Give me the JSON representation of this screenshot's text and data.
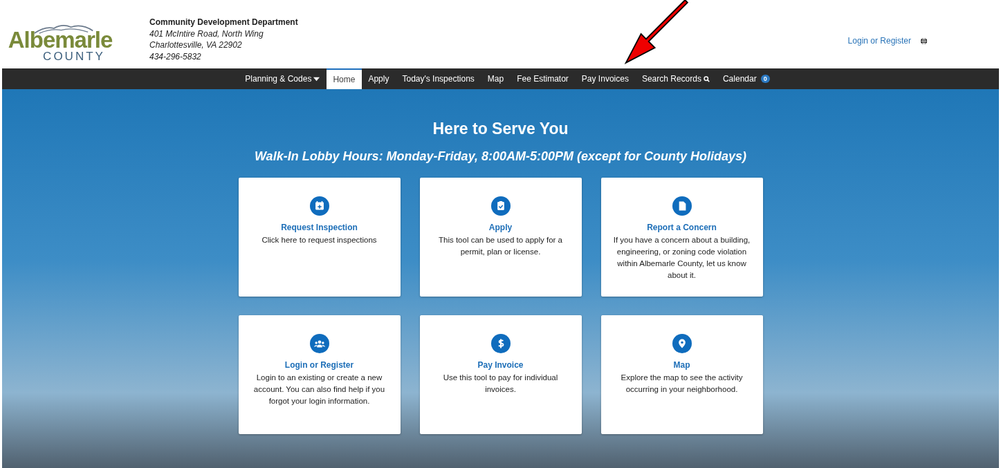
{
  "logo": {
    "name": "Albemarle",
    "sub": "COUNTY"
  },
  "department": {
    "name": "Community Development Department",
    "address_1": "401 McIntire Road, North Wing",
    "address_2": "Charlottesville, VA 22902",
    "phone": "434-296-5832"
  },
  "account_link": "Login or Register",
  "nav": [
    {
      "label": "Planning & Codes",
      "kind": "dropdown",
      "selected": false
    },
    {
      "label": "Home",
      "kind": "plain",
      "selected": true
    },
    {
      "label": "Apply",
      "kind": "plain",
      "selected": false
    },
    {
      "label": "Today's Inspections",
      "kind": "plain",
      "selected": false
    },
    {
      "label": "Map",
      "kind": "plain",
      "selected": false
    },
    {
      "label": "Fee Estimator",
      "kind": "plain",
      "selected": false
    },
    {
      "label": "Pay Invoices",
      "kind": "plain",
      "selected": false
    },
    {
      "label": "Search Records",
      "kind": "search",
      "selected": false
    },
    {
      "label": "Calendar",
      "kind": "badge",
      "badge": "0",
      "selected": false
    }
  ],
  "hero": {
    "title": "Here to Serve You",
    "subtitle": "Walk-In Lobby Hours: Monday-Friday, 8:00AM-5:00PM (except for County Holidays)"
  },
  "cards": [
    {
      "kind": "calendar",
      "title": "Request Inspection",
      "text": "Click here to request inspections"
    },
    {
      "kind": "clipboard",
      "title": "Apply",
      "text": "This tool can be used to apply for a permit, plan or license."
    },
    {
      "kind": "document",
      "title": "Report a Concern",
      "text": "If you have a concern about a building, engineering, or zoning code violation within Albemarle County, let us know about it."
    },
    {
      "kind": "users",
      "title": "Login or Register",
      "text": "Login to an existing or create a new account. You can also find help if you forgot your login information."
    },
    {
      "kind": "dollar",
      "title": "Pay Invoice",
      "text": "Use this tool to pay for individual invoices."
    },
    {
      "kind": "pin",
      "title": "Map",
      "text": "Explore the map to see the activity occurring in your neighborhood."
    }
  ]
}
